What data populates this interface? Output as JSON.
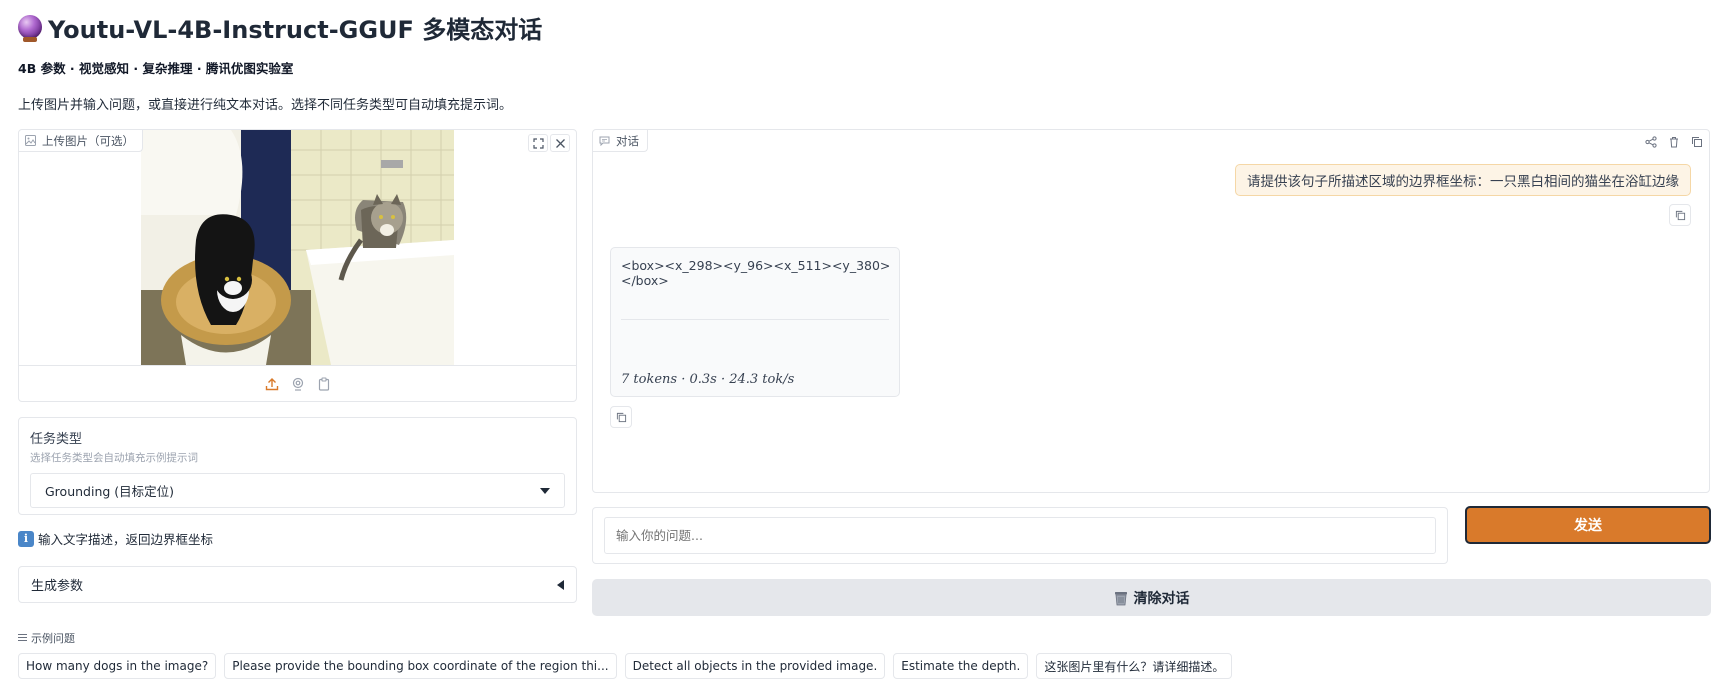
{
  "header": {
    "title": "Youtu-VL-4B-Instruct-GGUF 多模态对话",
    "subtitle": "4B 参数 · 视觉感知 · 复杂推理 · 腾讯优图实验室",
    "description": "上传图片并输入问题，或直接进行纯文本对话。选择不同任务类型可自动填充提示词。"
  },
  "upload": {
    "label": "上传图片（可选）"
  },
  "task": {
    "label": "任务类型",
    "info": "选择任务类型会自动填充示例提示词",
    "selected": "Grounding (目标定位)"
  },
  "hint": {
    "icon": "i",
    "text": "输入文字描述，返回边界框坐标"
  },
  "params": {
    "label": "生成参数"
  },
  "examples": {
    "label": "示例问题",
    "items": [
      "How many dogs in the image?",
      "Please provide the bounding box coordinate of the region thi...",
      "Detect all objects in the provided image.",
      "Estimate the depth.",
      "这张图片里有什么？请详细描述。"
    ]
  },
  "chat": {
    "label": "对话",
    "user_message": "请提供该句子所描述区域的边界框坐标：一只黑白相间的猫坐在浴缸边缘",
    "bot_message": "<box><x_298><y_96><x_511><y_380></box>",
    "bot_meta": "7 tokens · 0.3s · 24.3 tok/s"
  },
  "input": {
    "placeholder": "输入你的问题..."
  },
  "buttons": {
    "send": "发送",
    "clear": "清除对话"
  },
  "colors": {
    "accent": "#d97a2b",
    "user_bubble": "#fdf4e6",
    "border": "#e5e7eb"
  }
}
